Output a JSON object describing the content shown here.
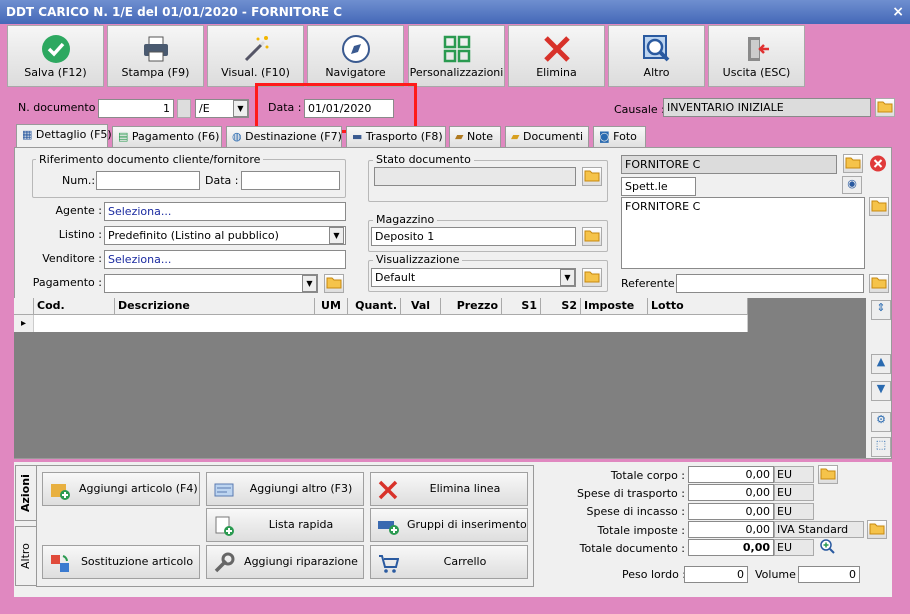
{
  "window": {
    "title": "DDT CARICO N. 1/E del 01/01/2020 - FORNITORE C",
    "close": "×"
  },
  "toolbar": [
    {
      "label": "Salva (F12)",
      "icon": "check-icon"
    },
    {
      "label": "Stampa (F9)",
      "icon": "printer-icon"
    },
    {
      "label": "Visual. (F10)",
      "icon": "magic-wand-icon"
    },
    {
      "label": "Navigatore",
      "icon": "compass-icon"
    },
    {
      "label": "Personalizzazioni",
      "icon": "grid-icon"
    },
    {
      "label": "Elimina",
      "icon": "delete-x-icon"
    },
    {
      "label": "Altro",
      "icon": "magnifier-icon"
    },
    {
      "label": "Uscita (ESC)",
      "icon": "exit-door-icon"
    }
  ],
  "header": {
    "ndoc_label": "N. documento :",
    "ndoc_value": "1",
    "series_value": "/E",
    "data_label": "Data :",
    "data_value": "01/01/2020",
    "causale_label": "Causale :",
    "causale_value": "INVENTARIO INIZIALE"
  },
  "tabs": [
    {
      "label": "Dettaglio (F5)",
      "icon": "table-icon"
    },
    {
      "label": "Pagamento (F6)",
      "icon": "money-icon"
    },
    {
      "label": "Destinazione (F7)",
      "icon": "globe-icon"
    },
    {
      "label": "Trasporto (F8)",
      "icon": "truck-icon"
    },
    {
      "label": "Note",
      "icon": "note-icon"
    },
    {
      "label": "Documenti",
      "icon": "folder-icon"
    },
    {
      "label": "Foto",
      "icon": "camera-icon"
    }
  ],
  "riferimento": {
    "title": "Riferimento documento cliente/fornitore",
    "num_label": "Num.:",
    "data_label": "Data :",
    "num_value": "",
    "data_value": ""
  },
  "fields": {
    "agente_label": "Agente :",
    "agente_value": "Seleziona...",
    "listino_label": "Listino :",
    "listino_value": "Predefinito (Listino al pubblico)",
    "venditore_label": "Venditore :",
    "venditore_value": "Seleziona...",
    "pagamento_label": "Pagamento :",
    "pagamento_value": ""
  },
  "stato": {
    "title": "Stato documento",
    "value": ""
  },
  "magazzino": {
    "title": "Magazzino",
    "value": "Deposito 1"
  },
  "visualizzazione": {
    "title": "Visualizzazione",
    "value": "Default"
  },
  "fornitore": {
    "name": "FORNITORE C",
    "salutation": "Spett.le",
    "address": "FORNITORE C",
    "referente_label": "Referente",
    "referente_value": ""
  },
  "grid": {
    "columns": [
      "Cod.",
      "Descrizione",
      "UM",
      "Quant.",
      "Val",
      "Prezzo",
      "S1",
      "S2",
      "Imposte",
      "Lotto"
    ],
    "row_marker": "▸"
  },
  "side_tabs": {
    "azioni": "Azioni",
    "altro": "Altro"
  },
  "actions": [
    {
      "label": "Aggiungi articolo (F4)",
      "icon": "add-article-icon"
    },
    {
      "label": "Aggiungi altro (F3)",
      "icon": "add-other-icon"
    },
    {
      "label": "Elimina linea",
      "icon": "delete-line-icon"
    },
    {
      "label": "Lista rapida",
      "icon": "quick-list-icon"
    },
    {
      "label": "Gruppi di inserimento",
      "icon": "insert-groups-icon"
    },
    {
      "label": "Sostituzione articolo",
      "icon": "replace-article-icon"
    },
    {
      "label": "Aggiungi riparazione",
      "icon": "wrench-icon"
    },
    {
      "label": "Carrello",
      "icon": "cart-icon"
    }
  ],
  "totals": [
    {
      "label": "Totale corpo :",
      "value": "0,00",
      "unit": "EU"
    },
    {
      "label": "Spese di trasporto :",
      "value": "0,00",
      "unit": "EU"
    },
    {
      "label": "Spese di incasso :",
      "value": "0,00",
      "unit": "EU"
    },
    {
      "label": "Totale imposte :",
      "value": "0,00",
      "unit": "IVA Standard"
    },
    {
      "label": "Totale documento :",
      "value": "0,00",
      "unit": "EU"
    }
  ],
  "weights": {
    "lordo_label": "Peso lordo :",
    "lordo_value": "0",
    "volume_label": "Volume :",
    "volume_value": "0"
  },
  "colors": {
    "accent_red": "#ff1a1a",
    "frame_pink": "#e490c6",
    "title_blue": "#4468b8"
  }
}
